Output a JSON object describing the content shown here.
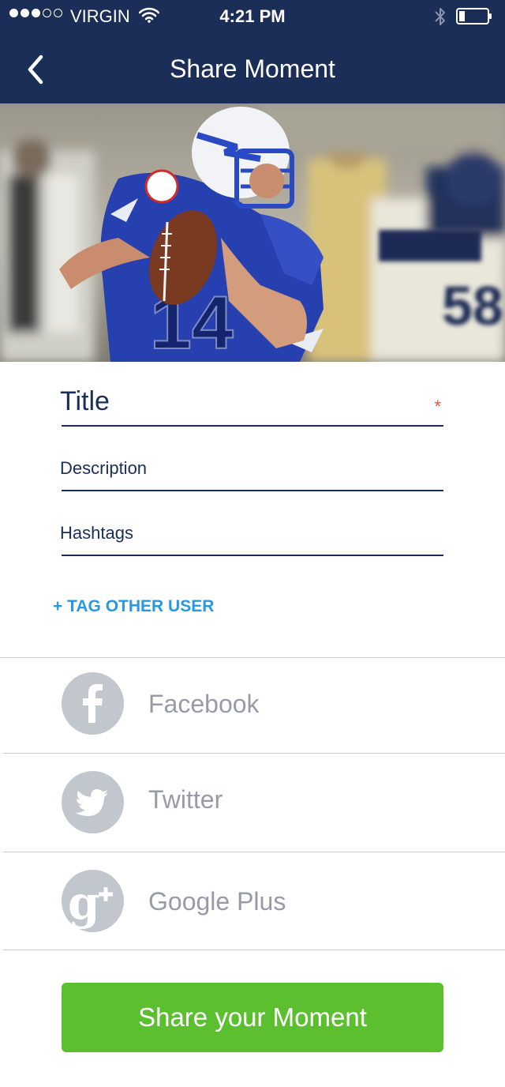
{
  "status_bar": {
    "carrier": "VIRGIN",
    "time": "4:21 PM",
    "signal_bars_full": 3,
    "signal_bars_total": 5
  },
  "nav": {
    "title": "Share Moment",
    "back_icon": "chevron-left-icon"
  },
  "hero": {
    "description_icon": "football-player-photo",
    "jersey_number": "14"
  },
  "form": {
    "title_placeholder": "Title",
    "required_mark": "*",
    "description_placeholder": "Description",
    "hashtags_placeholder": "Hashtags",
    "tag_other_user": "+ TAG OTHER USER"
  },
  "share": {
    "items": [
      {
        "label": "Facebook",
        "icon": "facebook-icon"
      },
      {
        "label": "Twitter",
        "icon": "twitter-icon"
      },
      {
        "label": "Google Plus",
        "icon": "google-plus-icon"
      }
    ]
  },
  "actions": {
    "share_button": "Share your Moment"
  },
  "colors": {
    "nav_bg": "#1b2e58",
    "accent_blue": "#2a97e0",
    "required_red": "#e2533a",
    "button_green": "#5cbf30",
    "icon_gray": "#c2c6cd",
    "label_gray": "#969ba7"
  }
}
